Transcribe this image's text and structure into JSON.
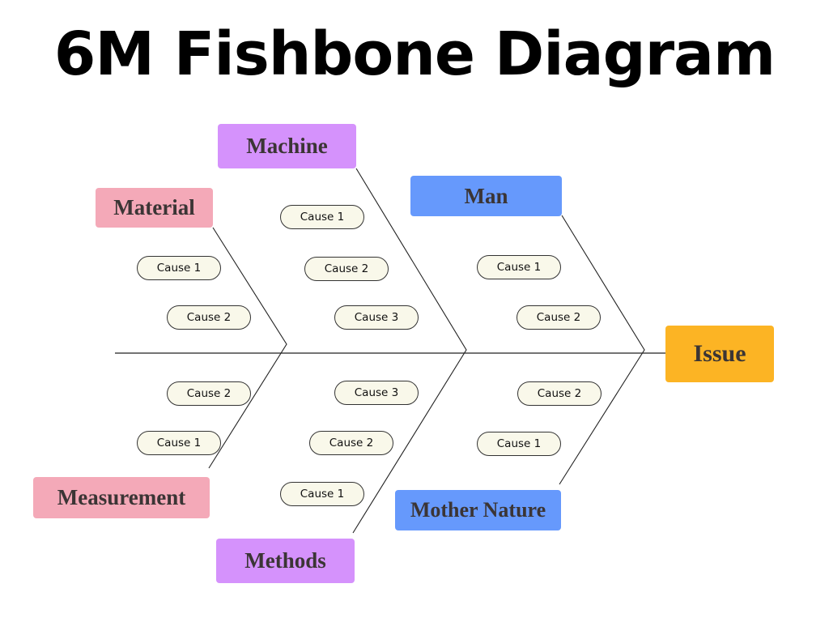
{
  "title": "6M Fishbone Diagram",
  "effect": {
    "label": "Issue",
    "color": "#fcb424"
  },
  "categories": {
    "material": {
      "label": "Material",
      "color": "#f4a9b8",
      "causes": [
        "Cause 1",
        "Cause 2"
      ]
    },
    "machine": {
      "label": "Machine",
      "color": "#d592fc",
      "causes": [
        "Cause 1",
        "Cause 2",
        "Cause 3"
      ]
    },
    "man": {
      "label": "Man",
      "color": "#6699fc",
      "causes": [
        "Cause 1",
        "Cause 2"
      ]
    },
    "measurement": {
      "label": "Measurement",
      "color": "#f4a9b8",
      "causes": [
        "Cause 2",
        "Cause 1"
      ]
    },
    "methods": {
      "label": "Methods",
      "color": "#d592fc",
      "causes": [
        "Cause 3",
        "Cause 2",
        "Cause 1"
      ]
    },
    "mother_nature": {
      "label": "Mother Nature",
      "color": "#6699fc",
      "causes": [
        "Cause 2",
        "Cause 1"
      ]
    }
  }
}
